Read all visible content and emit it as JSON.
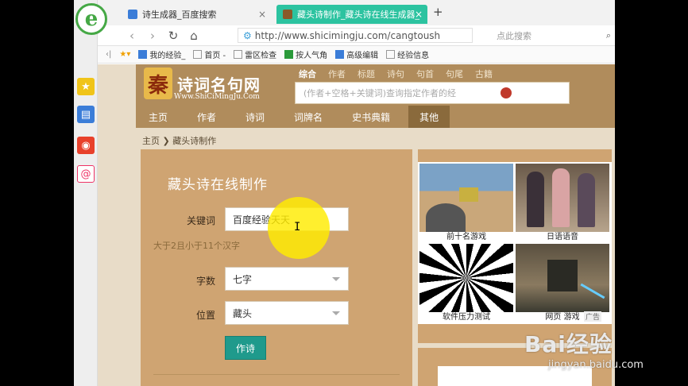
{
  "browser": {
    "tabs": [
      {
        "label": "诗生成器_百度搜索",
        "active": false
      },
      {
        "label": "藏头诗制作_藏头诗在线生成器_",
        "active": true
      }
    ],
    "new_tab": "+",
    "close": "×",
    "url": "http://www.shicimingju.com/cangtoush",
    "search_placeholder": "点此搜索",
    "bookmarks": [
      "我的经验_",
      "首页 -",
      "雷区检查",
      "按人气角",
      "高级编辑",
      "经验信息"
    ]
  },
  "site": {
    "logo_char": "秦",
    "name": "诗词名句网",
    "url_text": "Www.ShiCiMingJu.Com",
    "search_tabs": [
      "综合",
      "作者",
      "标题",
      "诗句",
      "句首",
      "句尾",
      "古籍"
    ],
    "search_placeholder": "(作者+空格+关键词)查询指定作者的经",
    "menu": [
      "主页",
      "作者",
      "诗词",
      "词牌名",
      "史书典籍",
      "其他"
    ],
    "breadcrumb": "主页 ❯ 藏头诗制作"
  },
  "form": {
    "title": "藏头诗在线制作",
    "keyword_label": "关键词",
    "keyword_value": "百度经验天天",
    "hint": "大于2且小于11个汉字",
    "chars_label": "字数",
    "chars_value": "七字",
    "position_label": "位置",
    "position_value": "藏头",
    "submit": "作诗"
  },
  "ads": {
    "items": [
      "前十名游戏",
      "日语语音",
      "软件压力测试",
      "网页 游戏"
    ],
    "ad_label": "广告"
  },
  "watermark": {
    "brand": "Bai经验",
    "domain": "jingyan.baidu.com"
  }
}
